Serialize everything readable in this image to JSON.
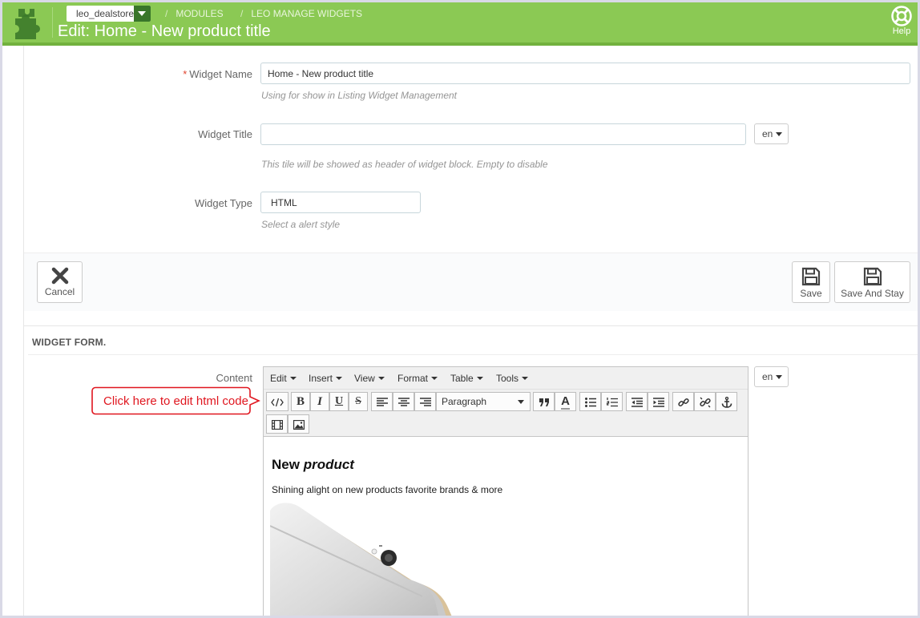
{
  "header": {
    "shop_name": "leo_dealstore",
    "breadcrumbs": [
      {
        "label": "MODULES"
      },
      {
        "label": "LEO MANAGE WIDGETS"
      }
    ],
    "title": "Edit: Home - New product title",
    "help_label": "Help",
    "colors": {
      "bar": "#8bc954",
      "accent": "#39762a"
    }
  },
  "form": {
    "widget_name": {
      "label": "Widget Name",
      "required_mark": "*",
      "value": "Home - New product title",
      "hint": "Using for show in Listing Widget Management"
    },
    "widget_title": {
      "label": "Widget Title",
      "value": "",
      "lang": "en",
      "hint": "This tile will be showed as header of widget block. Empty to disable"
    },
    "widget_type": {
      "label": "Widget Type",
      "value": "HTML",
      "hint": "Select a alert style"
    }
  },
  "actions": {
    "cancel_label": "Cancel",
    "save_label": "Save",
    "save_stay_label": "Save And Stay"
  },
  "widget_form": {
    "heading": "WIDGET FORM.",
    "content_label": "Content",
    "lang": "en",
    "menu": [
      "Edit",
      "Insert",
      "View",
      "Format",
      "Table",
      "Tools"
    ],
    "toolbar": {
      "icons": [
        "code-icon",
        "bold-icon",
        "italic-icon",
        "underline-icon",
        "strikethrough-icon",
        "align-left-icon",
        "align-center-icon",
        "align-right-icon",
        "blockquote-icon",
        "text-color-icon",
        "bullet-list-icon",
        "numbered-list-icon",
        "outdent-icon",
        "indent-icon",
        "link-icon",
        "unlink-icon",
        "anchor-icon",
        "video-icon",
        "image-icon"
      ],
      "bold": "B",
      "italic": "I",
      "underline": "U",
      "strike": "S",
      "format_select": "Paragraph",
      "text_color": "A"
    },
    "content": {
      "heading_plain": "New",
      "heading_italic": "product",
      "paragraph": "Shining alight on new products favorite brands & more"
    }
  },
  "annotation": {
    "text": "Click here to edit html code",
    "color": "#e0161f"
  }
}
